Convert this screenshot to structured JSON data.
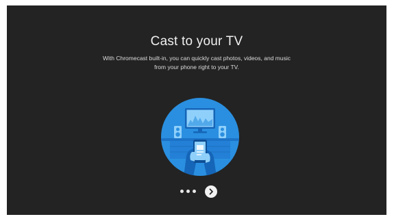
{
  "screen": {
    "title": "Cast to your TV",
    "description_line1": "With Chromecast built-in, you can quickly cast photos, videos, and music",
    "description_line2": "from your phone right to your TV."
  },
  "illustration": {
    "icon": "cast-to-tv-illustration",
    "colors": {
      "circle": "#2a8fe0",
      "dark": "#1565b8",
      "light": "#8fd0fb"
    }
  },
  "pager": {
    "dots_icon": "pagination-dots-icon",
    "next_icon": "chevron-right-icon"
  },
  "colors": {
    "background": "#232323",
    "text": "#f0f0f0"
  }
}
